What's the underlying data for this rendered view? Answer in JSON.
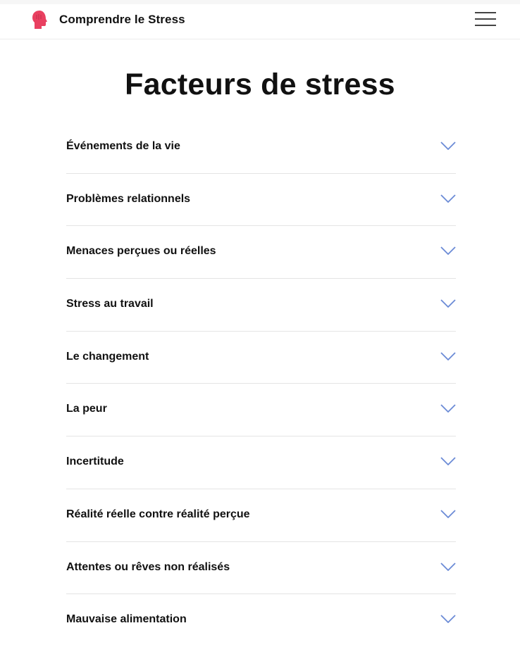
{
  "header": {
    "brand_name": "Comprendre le Stress",
    "logo_icon": "head-icon",
    "menu_icon": "hamburger-menu-icon",
    "accent_color": "#e94060"
  },
  "main": {
    "title": "Facteurs de stress",
    "chevron_color": "#6b8bd6",
    "items": [
      {
        "label": "Événements de la vie"
      },
      {
        "label": "Problèmes relationnels"
      },
      {
        "label": "Menaces perçues ou réelles"
      },
      {
        "label": "Stress au travail"
      },
      {
        "label": "Le changement"
      },
      {
        "label": "La peur"
      },
      {
        "label": "Incertitude"
      },
      {
        "label": "Réalité réelle contre réalité perçue"
      },
      {
        "label": "Attentes ou rêves non réalisés"
      },
      {
        "label": "Mauvaise alimentation"
      }
    ]
  }
}
